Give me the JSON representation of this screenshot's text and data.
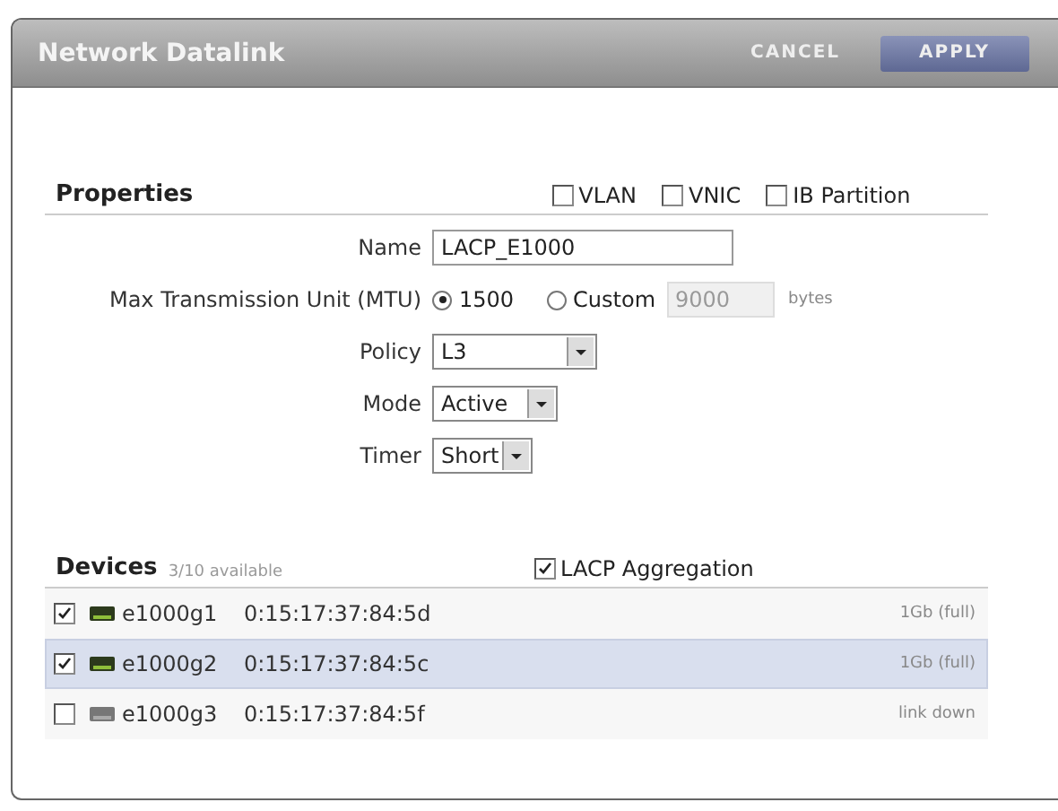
{
  "dialog": {
    "title": "Network Datalink",
    "buttons": [
      {
        "label": "CANCEL",
        "kind": "plain"
      },
      {
        "label": "APPLY",
        "kind": "primary"
      }
    ]
  },
  "properties": {
    "heading": "Properties",
    "options": [
      {
        "label": "VLAN",
        "checked": false
      },
      {
        "label": "VNIC",
        "checked": false
      },
      {
        "label": "IB Partition",
        "checked": false
      }
    ],
    "name": {
      "label": "Name",
      "value": "LACP_E1000"
    },
    "mtu": {
      "label": "Max Transmission Unit (MTU)",
      "choices": [
        {
          "label": "1500",
          "selected": true
        },
        {
          "label": "Custom",
          "selected": false
        }
      ],
      "custom_value": "9000",
      "unit": "bytes"
    },
    "selects": [
      {
        "label": "Policy",
        "value": "L3"
      },
      {
        "label": "Mode",
        "value": "Active"
      },
      {
        "label": "Timer",
        "value": "Short"
      }
    ]
  },
  "devices": {
    "heading": "Devices",
    "count": "3/10 available",
    "aggregation": {
      "label": "LACP Aggregation",
      "checked": true
    },
    "rows": [
      {
        "name": "e1000g1",
        "mac": "0:15:17:37:84:5d",
        "status": "1Gb (full)",
        "checked": true,
        "link_up": true,
        "selected": false
      },
      {
        "name": "e1000g2",
        "mac": "0:15:17:37:84:5c",
        "status": "1Gb (full)",
        "checked": true,
        "link_up": true,
        "selected": true
      },
      {
        "name": "e1000g3",
        "mac": "0:15:17:37:84:5f",
        "status": "link down",
        "checked": false,
        "link_up": false,
        "selected": false
      }
    ]
  }
}
